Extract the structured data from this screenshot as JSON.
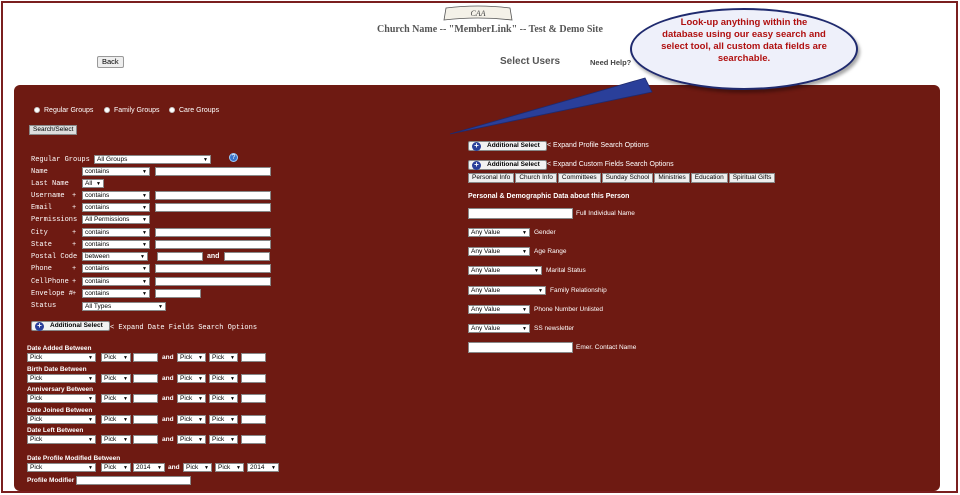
{
  "header": {
    "logo_text": "CAA",
    "site_title": "Church Name -- \"MemberLink\" -- Test & Demo Site",
    "back_label": "Back",
    "page_title": "Select Users",
    "need_help": "Need Help?"
  },
  "callout": {
    "text": "Look-up anything within the database using our easy search and select tool, all custom data fields are searchable."
  },
  "group_types": {
    "regular": "Regular Groups",
    "family": "Family Groups",
    "care": "Care Groups"
  },
  "search_select_label": "Search/Select",
  "left_form": {
    "regular_groups_label": "Regular Groups",
    "regular_groups_value": "All Groups",
    "name_label": "Name",
    "name_op": "contains",
    "last_name_label": "Last Name",
    "last_name_value": "All",
    "username_label": "Username",
    "username_op": "contains",
    "email_label": "Email",
    "email_op": "contains",
    "permissions_label": "Permissions",
    "permissions_value": "All Permissions",
    "city_label": "City",
    "city_op": "contains",
    "state_label": "State",
    "state_op": "contains",
    "postal_label": "Postal Code",
    "postal_op": "between",
    "postal_and": "and",
    "phone_label": "Phone",
    "phone_op": "contains",
    "cellphone_label": "CellPhone",
    "cellphone_op": "contains",
    "envelope_label": "Envelope #",
    "envelope_op": "contains",
    "status_label": "Status",
    "status_value": "All Types",
    "plus_mark": "+"
  },
  "additional_select_label": "Additional Select",
  "date_fields_text": "< Expand Date Fields Search Options",
  "date_rows": [
    {
      "label": "Date Added Between"
    },
    {
      "label": "Birth Date Between"
    },
    {
      "label": "Anniversary Between"
    },
    {
      "label": "Date Joined Between"
    },
    {
      "label": "Date Left Between"
    }
  ],
  "pick": "Pick",
  "and": "and",
  "profile_modified_label": "Date Profile Modified Between",
  "year_value": "2014",
  "profile_modifier_label": "Profile Modifier",
  "right": {
    "expand_profile_text": "< Expand Profile Search Options",
    "expand_custom_text": "< Expand Custom Fields Search Options",
    "tabs": [
      "Personal Info",
      "Church Info",
      "Committees",
      "Sunday School",
      "Ministries",
      "Education",
      "Spiritual Gifts"
    ],
    "section_title": "Personal & Demographic Data about this Person",
    "full_name_label": "Full Individual Name",
    "any_value": "Any Value",
    "fields": [
      "Gender",
      "Age Range",
      "Marital Status",
      "Family Relationship",
      "Phone Number Unlisted",
      "SS newsletter"
    ],
    "emer_label": "Emer. Contact Name"
  },
  "colors": {
    "panel": "#6e1a12",
    "callout_text": "#b01010",
    "callout_border": "#1f2a6e"
  }
}
